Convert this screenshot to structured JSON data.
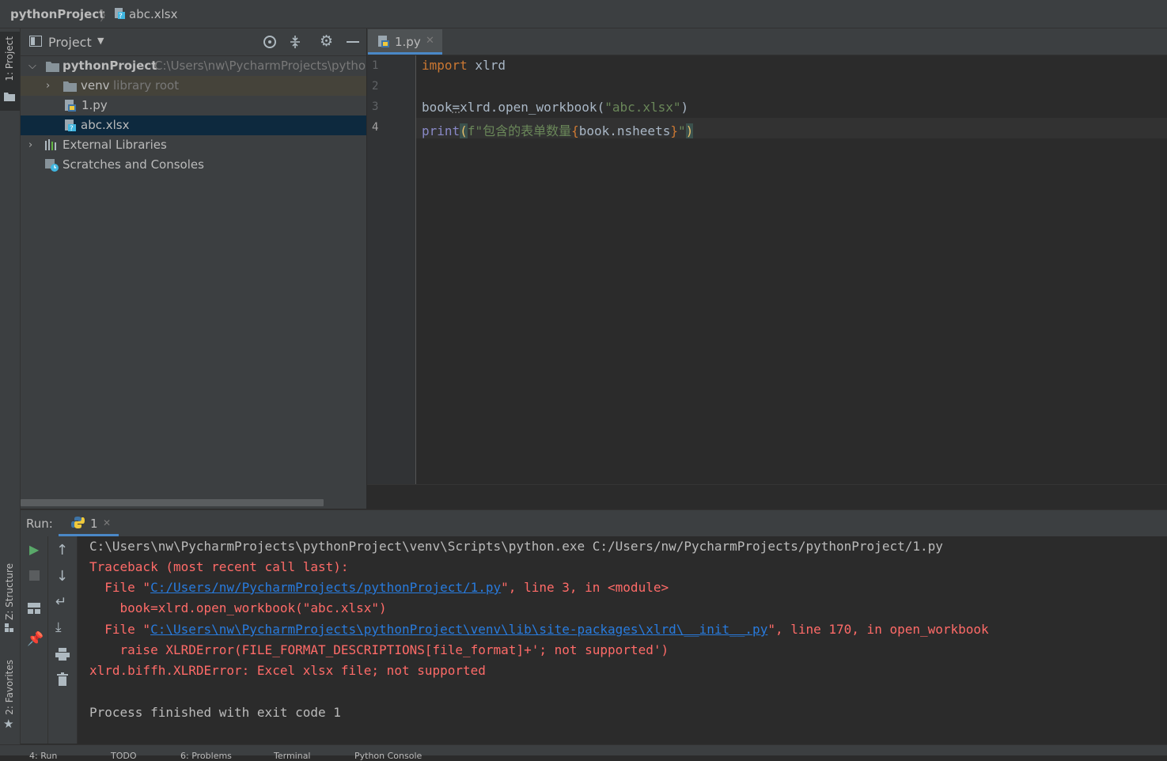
{
  "navbar": {
    "project": "pythonProject",
    "file": "abc.xlsx"
  },
  "left_stripe": {
    "project_tab": "1: Project",
    "structure_tab": "Z: Structure",
    "favorites_tab": "2: Favorites"
  },
  "project_panel": {
    "title": "Project",
    "tree": [
      {
        "label": "pythonProject",
        "hint": "C:\\Users\\nw\\PycharmProjects\\pythonProject"
      },
      {
        "label": "venv",
        "hint": "library root"
      },
      {
        "label": "1.py"
      },
      {
        "label": "abc.xlsx"
      },
      {
        "label": "External Libraries"
      },
      {
        "label": "Scratches and Consoles"
      }
    ]
  },
  "editor": {
    "tab_label": "1.py",
    "line_numbers": [
      "1",
      "2",
      "3",
      "4"
    ],
    "lines": {
      "l1_kw": "import",
      "l1_rest": " xlrd",
      "l3_a": "book",
      "l3_b": "=",
      "l3_c": "xlrd.open_workbook(",
      "l3_str": "\"abc.xlsx\"",
      "l3_d": ")",
      "l4_print": "print",
      "l4_paren": "(",
      "l4_fstr": "f\"包含的表单数量",
      "l4_lbrace": "{",
      "l4_expr": "book.nsheets",
      "l4_rbrace": "}",
      "l4_quote": "\"",
      "l4_close": ")"
    }
  },
  "run_panel": {
    "label": "Run:",
    "tab_label": "1",
    "console": {
      "cmd": "C:\\Users\\nw\\PycharmProjects\\pythonProject\\venv\\Scripts\\python.exe C:/Users/nw/PycharmProjects/pythonProject/1.py",
      "traceback": "Traceback (most recent call last):",
      "f1_pre": "  File \"",
      "f1_link": "C:/Users/nw/PycharmProjects/pythonProject/1.py",
      "f1_post": "\", line 3, in <module>",
      "f1_code": "    book=xlrd.open_workbook(\"abc.xlsx\")",
      "f2_pre": "  File \"",
      "f2_link": "C:\\Users\\nw\\PycharmProjects\\pythonProject\\venv\\lib\\site-packages\\xlrd\\__init__.py",
      "f2_post": "\", line 170, in open_workbook",
      "f2_code": "    raise XLRDError(FILE_FORMAT_DESCRIPTIONS[file_format]+'; not supported')",
      "error": "xlrd.biffh.XLRDError: Excel xlsx file; not supported",
      "exit": "Process finished with exit code 1"
    }
  },
  "status_bar": {
    "items": [
      "4: Run",
      "TODO",
      "6: Problems",
      "Terminal",
      "Python Console"
    ]
  }
}
